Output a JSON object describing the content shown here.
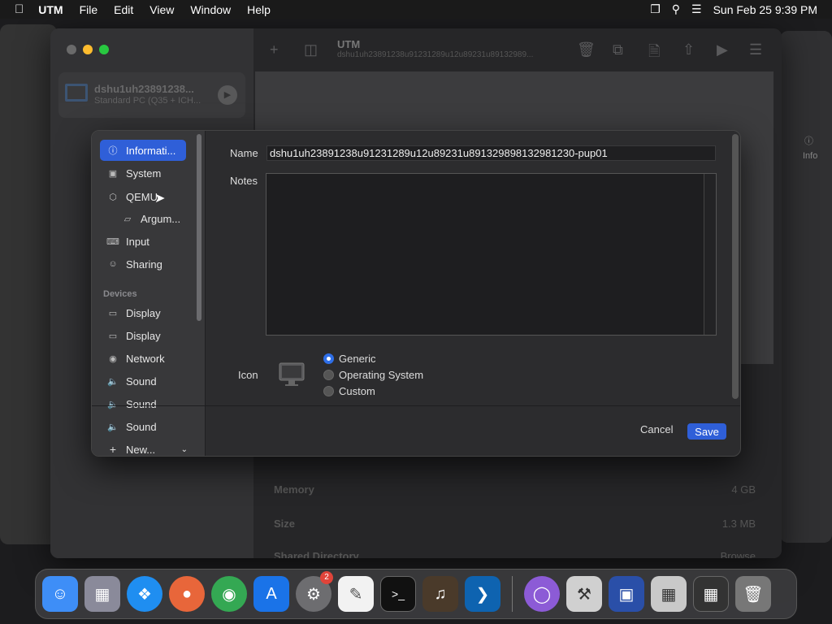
{
  "menubar": {
    "apple": "",
    "app": "UTM",
    "items": [
      "File",
      "Edit",
      "View",
      "Window",
      "Help"
    ],
    "datetime": "Sun Feb 25  9:39 PM"
  },
  "toolbar": {
    "title": "UTM",
    "subtitle": "dshu1uh23891238u91231289u12u89231u89132989..."
  },
  "vm": {
    "name": "dshu1uh23891238...",
    "desc": "Standard PC (Q35 + ICH..."
  },
  "sidebar": {
    "items": [
      {
        "label": "Informati...",
        "icon": "info-icon"
      },
      {
        "label": "System",
        "icon": "chip-icon"
      },
      {
        "label": "QEMU",
        "icon": "cube-icon"
      },
      {
        "label": "Argum...",
        "icon": "terminal-icon"
      },
      {
        "label": "Input",
        "icon": "keyboard-icon"
      },
      {
        "label": "Sharing",
        "icon": "person-icon"
      }
    ],
    "devices_header": "Devices",
    "devices": [
      {
        "label": "Display",
        "icon": "display-icon"
      },
      {
        "label": "Display",
        "icon": "display-icon"
      },
      {
        "label": "Network",
        "icon": "globe-icon"
      },
      {
        "label": "Sound",
        "icon": "speaker-icon"
      },
      {
        "label": "Sound",
        "icon": "speaker-icon"
      },
      {
        "label": "Sound",
        "icon": "speaker-icon"
      }
    ],
    "new_label": "New..."
  },
  "form": {
    "name_label": "Name",
    "name_value": "dshu1uh23891238u91231289u12u89231u891329898132981230-pup01",
    "notes_label": "Notes",
    "icon_label": "Icon",
    "icon_options": [
      "Generic",
      "Operating System",
      "Custom"
    ],
    "icon_selected": "Generic",
    "cancel": "Cancel",
    "save": "Save"
  },
  "background_rows": [
    {
      "label": "Memory",
      "value": "4 GB"
    },
    {
      "label": "Size",
      "value": "1.3 MB"
    },
    {
      "label": "Shared Directory",
      "value": "Browse"
    }
  ],
  "dock": {
    "apps": [
      "Finder",
      "Launchpad",
      "Safari",
      "Firefox",
      "Chrome",
      "App Store",
      "System Settings",
      "TextEdit",
      "Terminal",
      "GarageBand",
      "VS Code",
      "Disk Utility",
      "Utilities",
      "UTM",
      "Boot Camp",
      "Calculator",
      "Trash"
    ],
    "settings_badge": "2"
  },
  "colors": {
    "accent": "#2f5fd8",
    "close": "#ff5f57",
    "minimize": "#febc2e",
    "zoom": "#28c840"
  }
}
